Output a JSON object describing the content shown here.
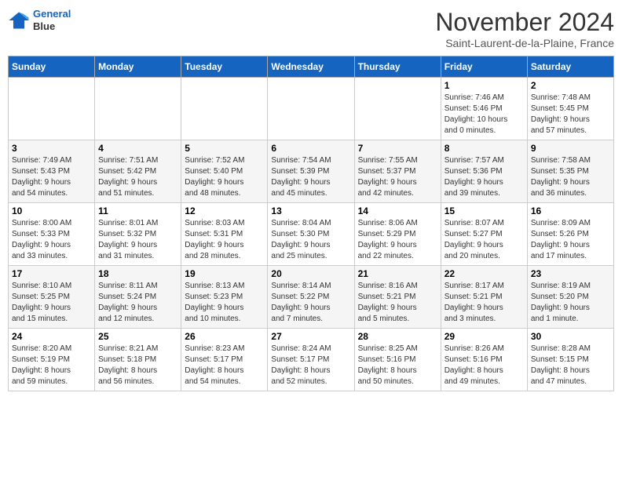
{
  "logo": {
    "line1": "General",
    "line2": "Blue"
  },
  "title": "November 2024",
  "subtitle": "Saint-Laurent-de-la-Plaine, France",
  "days_of_week": [
    "Sunday",
    "Monday",
    "Tuesday",
    "Wednesday",
    "Thursday",
    "Friday",
    "Saturday"
  ],
  "weeks": [
    [
      {
        "day": "",
        "info": ""
      },
      {
        "day": "",
        "info": ""
      },
      {
        "day": "",
        "info": ""
      },
      {
        "day": "",
        "info": ""
      },
      {
        "day": "",
        "info": ""
      },
      {
        "day": "1",
        "info": "Sunrise: 7:46 AM\nSunset: 5:46 PM\nDaylight: 10 hours\nand 0 minutes."
      },
      {
        "day": "2",
        "info": "Sunrise: 7:48 AM\nSunset: 5:45 PM\nDaylight: 9 hours\nand 57 minutes."
      }
    ],
    [
      {
        "day": "3",
        "info": "Sunrise: 7:49 AM\nSunset: 5:43 PM\nDaylight: 9 hours\nand 54 minutes."
      },
      {
        "day": "4",
        "info": "Sunrise: 7:51 AM\nSunset: 5:42 PM\nDaylight: 9 hours\nand 51 minutes."
      },
      {
        "day": "5",
        "info": "Sunrise: 7:52 AM\nSunset: 5:40 PM\nDaylight: 9 hours\nand 48 minutes."
      },
      {
        "day": "6",
        "info": "Sunrise: 7:54 AM\nSunset: 5:39 PM\nDaylight: 9 hours\nand 45 minutes."
      },
      {
        "day": "7",
        "info": "Sunrise: 7:55 AM\nSunset: 5:37 PM\nDaylight: 9 hours\nand 42 minutes."
      },
      {
        "day": "8",
        "info": "Sunrise: 7:57 AM\nSunset: 5:36 PM\nDaylight: 9 hours\nand 39 minutes."
      },
      {
        "day": "9",
        "info": "Sunrise: 7:58 AM\nSunset: 5:35 PM\nDaylight: 9 hours\nand 36 minutes."
      }
    ],
    [
      {
        "day": "10",
        "info": "Sunrise: 8:00 AM\nSunset: 5:33 PM\nDaylight: 9 hours\nand 33 minutes."
      },
      {
        "day": "11",
        "info": "Sunrise: 8:01 AM\nSunset: 5:32 PM\nDaylight: 9 hours\nand 31 minutes."
      },
      {
        "day": "12",
        "info": "Sunrise: 8:03 AM\nSunset: 5:31 PM\nDaylight: 9 hours\nand 28 minutes."
      },
      {
        "day": "13",
        "info": "Sunrise: 8:04 AM\nSunset: 5:30 PM\nDaylight: 9 hours\nand 25 minutes."
      },
      {
        "day": "14",
        "info": "Sunrise: 8:06 AM\nSunset: 5:29 PM\nDaylight: 9 hours\nand 22 minutes."
      },
      {
        "day": "15",
        "info": "Sunrise: 8:07 AM\nSunset: 5:27 PM\nDaylight: 9 hours\nand 20 minutes."
      },
      {
        "day": "16",
        "info": "Sunrise: 8:09 AM\nSunset: 5:26 PM\nDaylight: 9 hours\nand 17 minutes."
      }
    ],
    [
      {
        "day": "17",
        "info": "Sunrise: 8:10 AM\nSunset: 5:25 PM\nDaylight: 9 hours\nand 15 minutes."
      },
      {
        "day": "18",
        "info": "Sunrise: 8:11 AM\nSunset: 5:24 PM\nDaylight: 9 hours\nand 12 minutes."
      },
      {
        "day": "19",
        "info": "Sunrise: 8:13 AM\nSunset: 5:23 PM\nDaylight: 9 hours\nand 10 minutes."
      },
      {
        "day": "20",
        "info": "Sunrise: 8:14 AM\nSunset: 5:22 PM\nDaylight: 9 hours\nand 7 minutes."
      },
      {
        "day": "21",
        "info": "Sunrise: 8:16 AM\nSunset: 5:21 PM\nDaylight: 9 hours\nand 5 minutes."
      },
      {
        "day": "22",
        "info": "Sunrise: 8:17 AM\nSunset: 5:21 PM\nDaylight: 9 hours\nand 3 minutes."
      },
      {
        "day": "23",
        "info": "Sunrise: 8:19 AM\nSunset: 5:20 PM\nDaylight: 9 hours\nand 1 minute."
      }
    ],
    [
      {
        "day": "24",
        "info": "Sunrise: 8:20 AM\nSunset: 5:19 PM\nDaylight: 8 hours\nand 59 minutes."
      },
      {
        "day": "25",
        "info": "Sunrise: 8:21 AM\nSunset: 5:18 PM\nDaylight: 8 hours\nand 56 minutes."
      },
      {
        "day": "26",
        "info": "Sunrise: 8:23 AM\nSunset: 5:17 PM\nDaylight: 8 hours\nand 54 minutes."
      },
      {
        "day": "27",
        "info": "Sunrise: 8:24 AM\nSunset: 5:17 PM\nDaylight: 8 hours\nand 52 minutes."
      },
      {
        "day": "28",
        "info": "Sunrise: 8:25 AM\nSunset: 5:16 PM\nDaylight: 8 hours\nand 50 minutes."
      },
      {
        "day": "29",
        "info": "Sunrise: 8:26 AM\nSunset: 5:16 PM\nDaylight: 8 hours\nand 49 minutes."
      },
      {
        "day": "30",
        "info": "Sunrise: 8:28 AM\nSunset: 5:15 PM\nDaylight: 8 hours\nand 47 minutes."
      }
    ]
  ]
}
